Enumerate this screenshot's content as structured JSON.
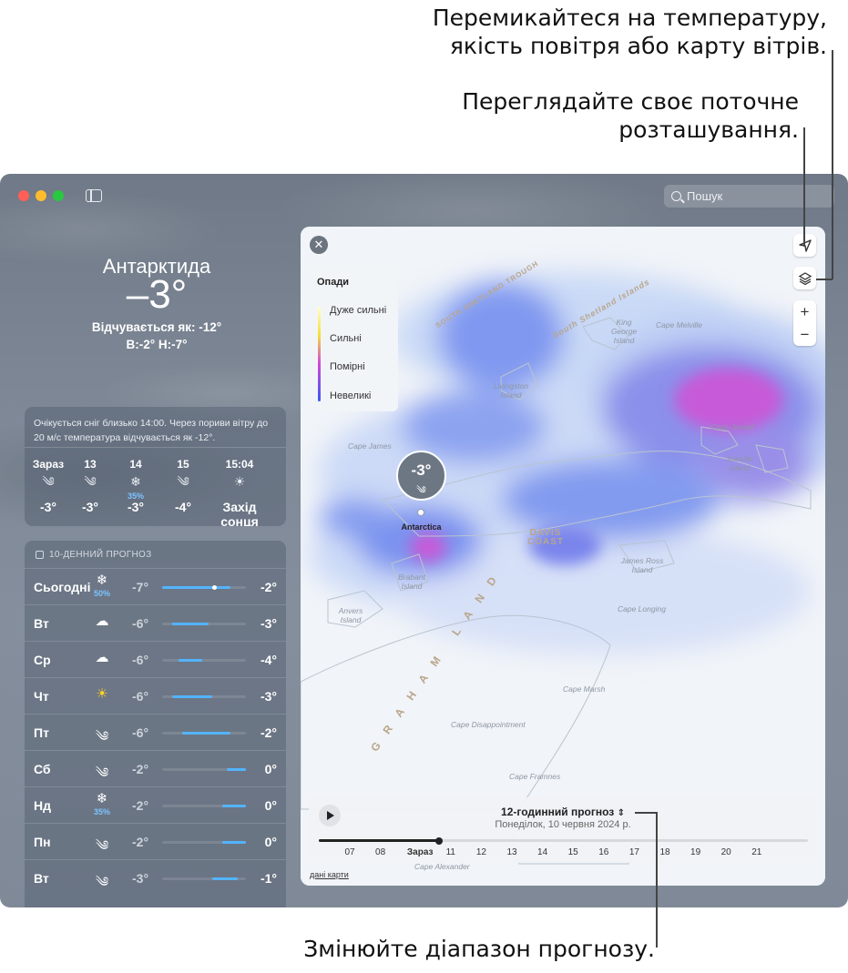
{
  "callouts": {
    "layers_line1": "Перемикайтеся на температуру,",
    "layers_line2": "якість повітря або карту вітрів.",
    "location_line1": "Переглядайте своє поточне",
    "location_line2": "розташування.",
    "range": "Змінюйте діапазон прогнозу."
  },
  "window": {
    "search_placeholder": "Пошук",
    "traffic_colors": [
      "#ff5f57",
      "#febc2e",
      "#28c840"
    ]
  },
  "current": {
    "city": "Антарктида",
    "temperature": "–3°",
    "feels_like": "Відчувається як: -12°",
    "high_low": "В:-2° Н:-7°"
  },
  "hourly": {
    "summary": "Очікується сніг близько 14:00. Через пориви вітру до 20 м/с температура відчувається як -12°.",
    "items": [
      {
        "time": "Зараз",
        "icon": "wind-icon",
        "glyph": "༄",
        "prob": "",
        "temp": "-3°"
      },
      {
        "time": "13",
        "icon": "wind-icon",
        "glyph": "༄",
        "prob": "",
        "temp": "-3°"
      },
      {
        "time": "14",
        "icon": "snowflake-icon",
        "glyph": "❄",
        "prob": "35%",
        "temp": "-3°"
      },
      {
        "time": "15",
        "icon": "wind-icon",
        "glyph": "༄",
        "prob": "",
        "temp": "-4°"
      },
      {
        "time": "15:04",
        "icon": "sunset-icon",
        "glyph": "☀",
        "prob": "",
        "temp": "Захід сонця"
      }
    ]
  },
  "daily": {
    "title": "10-ДЕННИЙ ПРОГНОЗ",
    "days": [
      {
        "name": "Сьогодні",
        "icon": "snowflake-icon",
        "glyph": "❄",
        "prob": "50%",
        "low": "-7°",
        "high": "-2°",
        "range": [
          0.0,
          0.82
        ],
        "current": 0.62
      },
      {
        "name": "Вт",
        "icon": "cloud-icon",
        "glyph": "☁",
        "prob": "",
        "low": "-6°",
        "high": "-3°",
        "range": [
          0.12,
          0.55
        ]
      },
      {
        "name": "Ср",
        "icon": "cloud-icon",
        "glyph": "☁",
        "prob": "",
        "low": "-6°",
        "high": "-4°",
        "range": [
          0.2,
          0.48
        ]
      },
      {
        "name": "Чт",
        "icon": "sun-icon",
        "glyph": "☀",
        "prob": "",
        "low": "-6°",
        "high": "-3°",
        "range": [
          0.12,
          0.6
        ]
      },
      {
        "name": "Пт",
        "icon": "wind-icon",
        "glyph": "༄",
        "prob": "",
        "low": "-6°",
        "high": "-2°",
        "range": [
          0.24,
          0.82
        ]
      },
      {
        "name": "Сб",
        "icon": "wind-icon",
        "glyph": "༄",
        "prob": "",
        "low": "-2°",
        "high": "0°",
        "range": [
          0.77,
          1.0
        ]
      },
      {
        "name": "Нд",
        "icon": "snowflake-icon",
        "glyph": "❄",
        "prob": "35%",
        "low": "-2°",
        "high": "0°",
        "range": [
          0.72,
          1.0
        ]
      },
      {
        "name": "Пн",
        "icon": "wind-icon",
        "glyph": "༄",
        "prob": "",
        "low": "-2°",
        "high": "0°",
        "range": [
          0.72,
          1.0
        ]
      },
      {
        "name": "Вт",
        "icon": "wind-icon",
        "glyph": "༄",
        "prob": "",
        "low": "-3°",
        "high": "-1°",
        "range": [
          0.6,
          0.9
        ]
      }
    ]
  },
  "map": {
    "legend": {
      "title": "Опади",
      "items": [
        "Дуже сильні",
        "Сильні",
        "Помірні",
        "Невеликі"
      ]
    },
    "pin": {
      "temp": "-3°",
      "label": "Antarctica"
    },
    "places": [
      "King George Island",
      "Cape Melville",
      "Livingston Island",
      "Cape Juncal",
      "Joinville Island",
      "Cape James",
      "James Ross Island",
      "Brabant Island",
      "Anvers Island",
      "Cape Longing",
      "Cape Marsh",
      "Cape Disappointment",
      "Cape Framnes",
      "Cape Alexander"
    ],
    "coast_labels": [
      "DAVIS COAST",
      "SOUTH SHETLAND TROUGH",
      "South Shetland Islands",
      "GRAHAM LAND"
    ],
    "timeline": {
      "title": "12-годинний прогноз",
      "subtitle": "Понеділок, 10 червня 2024 р.",
      "hours": [
        "07",
        "08",
        "Зараз",
        "11",
        "12",
        "13",
        "14",
        "15",
        "16",
        "17",
        "18",
        "19",
        "20",
        "21"
      ],
      "now_index": 2,
      "progress": 0.245
    },
    "data_link": "дані карти"
  }
}
